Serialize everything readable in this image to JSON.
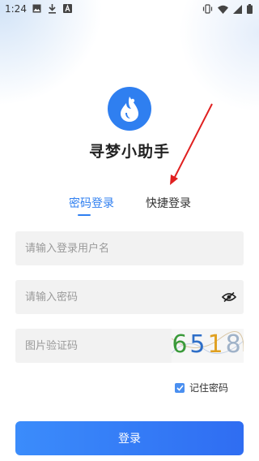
{
  "status_bar": {
    "time": "1:24",
    "left_icons": [
      "image-icon",
      "download-icon",
      "a-icon"
    ],
    "right_icons": [
      "vibrate-icon",
      "wifi-icon",
      "signal-icon",
      "battery-icon"
    ]
  },
  "app": {
    "title": "寻梦小助手",
    "logo_icon": "water-drop-logo-icon",
    "brand_color": "#2f7ff0"
  },
  "tabs": [
    {
      "label": "密码登录",
      "active": true
    },
    {
      "label": "快捷登录",
      "active": false
    }
  ],
  "form": {
    "username": {
      "value": "",
      "placeholder": "请输入登录用户名"
    },
    "password": {
      "value": "",
      "placeholder": "请输入密码"
    },
    "captcha": {
      "value": "",
      "placeholder": "图片验证码",
      "image_text": [
        "6",
        "5",
        "1",
        "8"
      ]
    },
    "remember": {
      "label": "记住密码",
      "checked": true
    },
    "submit_label": "登录"
  }
}
